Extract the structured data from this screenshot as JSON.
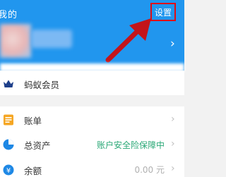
{
  "header": {
    "title": "我的",
    "settings_label": "设置",
    "background_color": "#2196ee",
    "highlight_color": "#e00c12"
  },
  "profile": {
    "chevron_icon": "chevron-right-icon"
  },
  "menu": {
    "member": {
      "label": "蚂蚁会员",
      "icon": "crown-icon"
    },
    "bill": {
      "label": "账单",
      "icon": "bill-icon"
    },
    "assets": {
      "label": "总资产",
      "status": "账户安全险保障中",
      "icon": "pie-chart-icon"
    },
    "balance": {
      "label": "余额",
      "amount": "0.00 元",
      "icon": "yuan-icon"
    }
  },
  "colors": {
    "accent_green": "#2aa876",
    "bill_orange": "#f5a623",
    "assets_blue": "#1e88e5",
    "member_navy": "#1d3f8a"
  }
}
